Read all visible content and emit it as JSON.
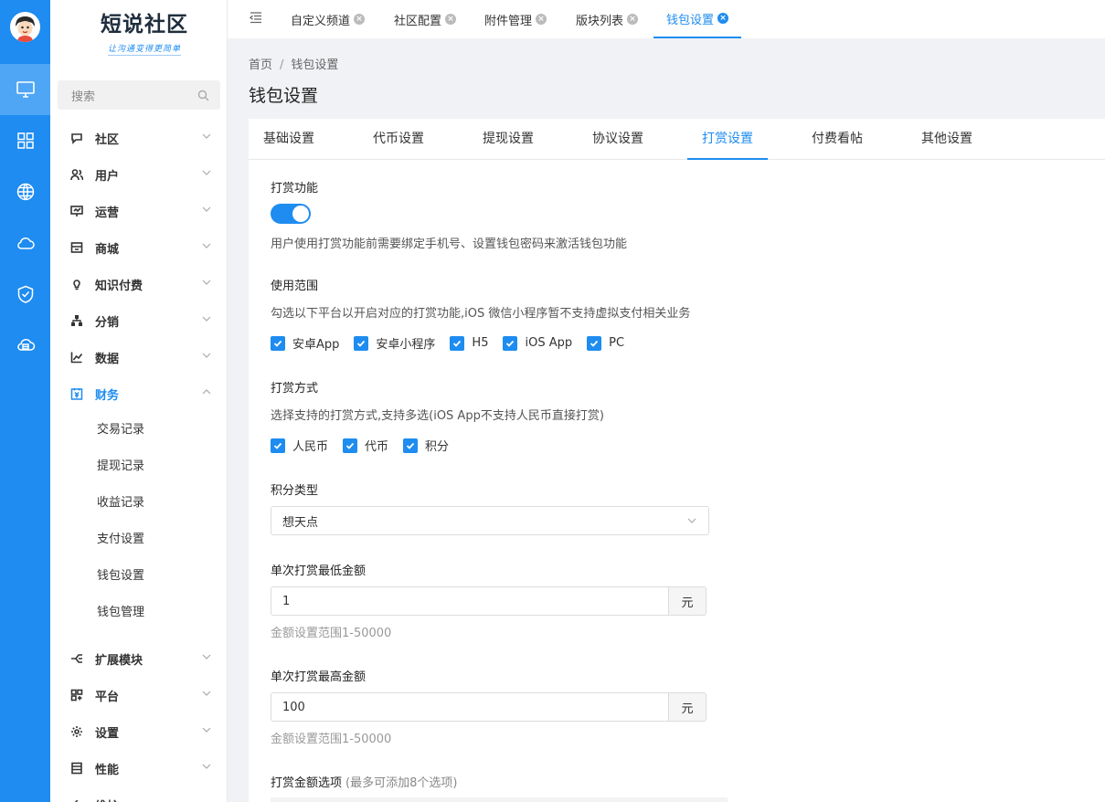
{
  "sidebar": {
    "logo_title": "短说社区",
    "logo_subtitle": "让沟通变得更简单",
    "search_placeholder": "搜索",
    "menu": [
      {
        "label": "社区"
      },
      {
        "label": "用户"
      },
      {
        "label": "运营"
      },
      {
        "label": "商城"
      },
      {
        "label": "知识付费"
      },
      {
        "label": "分销"
      },
      {
        "label": "数据"
      },
      {
        "label": "财务"
      }
    ],
    "finance_sub": [
      "交易记录",
      "提现记录",
      "收益记录",
      "支付设置",
      "钱包设置",
      "钱包管理"
    ],
    "menu_bottom": [
      {
        "label": "扩展模块"
      },
      {
        "label": "平台"
      },
      {
        "label": "设置"
      },
      {
        "label": "性能"
      },
      {
        "label": "维护"
      }
    ]
  },
  "topbar": {
    "tabs": [
      "自定义频道",
      "社区配置",
      "附件管理",
      "版块列表",
      "钱包设置"
    ],
    "active_tab": "钱包设置"
  },
  "breadcrumb": {
    "home": "首页",
    "separator": "/",
    "current": "钱包设置"
  },
  "page_title": "钱包设置",
  "content_tabs": [
    "基础设置",
    "代币设置",
    "提现设置",
    "协议设置",
    "打赏设置",
    "付费看帖",
    "其他设置"
  ],
  "active_content_tab": "打赏设置",
  "reward": {
    "feature_title": "打赏功能",
    "feature_enabled": true,
    "feature_help": "用户使用打赏功能前需要绑定手机号、设置钱包密码来激活钱包功能",
    "scope_title": "使用范围",
    "scope_help": "勾选以下平台以开启对应的打赏功能,iOS 微信小程序暂不支持虚拟支付相关业务",
    "platforms": [
      "安卓App",
      "安卓小程序",
      "H5",
      "iOS App",
      "PC"
    ],
    "method_title": "打赏方式",
    "method_help": "选择支持的打赏方式,支持多选(iOS App不支持人民币直接打赏)",
    "methods": [
      "人民币",
      "代币",
      "积分"
    ],
    "points_type_title": "积分类型",
    "points_type_value": "想天点",
    "min_title": "单次打赏最低金额",
    "min_value": "1",
    "min_unit": "元",
    "min_hint": "金额设置范围1-50000",
    "max_title": "单次打赏最高金额",
    "max_value": "100",
    "max_unit": "元",
    "max_hint": "金额设置范围1-50000",
    "options_title": "打赏金额选项",
    "options_note": "(最多可添加8个选项)"
  },
  "colors": {
    "primary": "#1e8cf0",
    "rail": "#1e8cf0"
  }
}
